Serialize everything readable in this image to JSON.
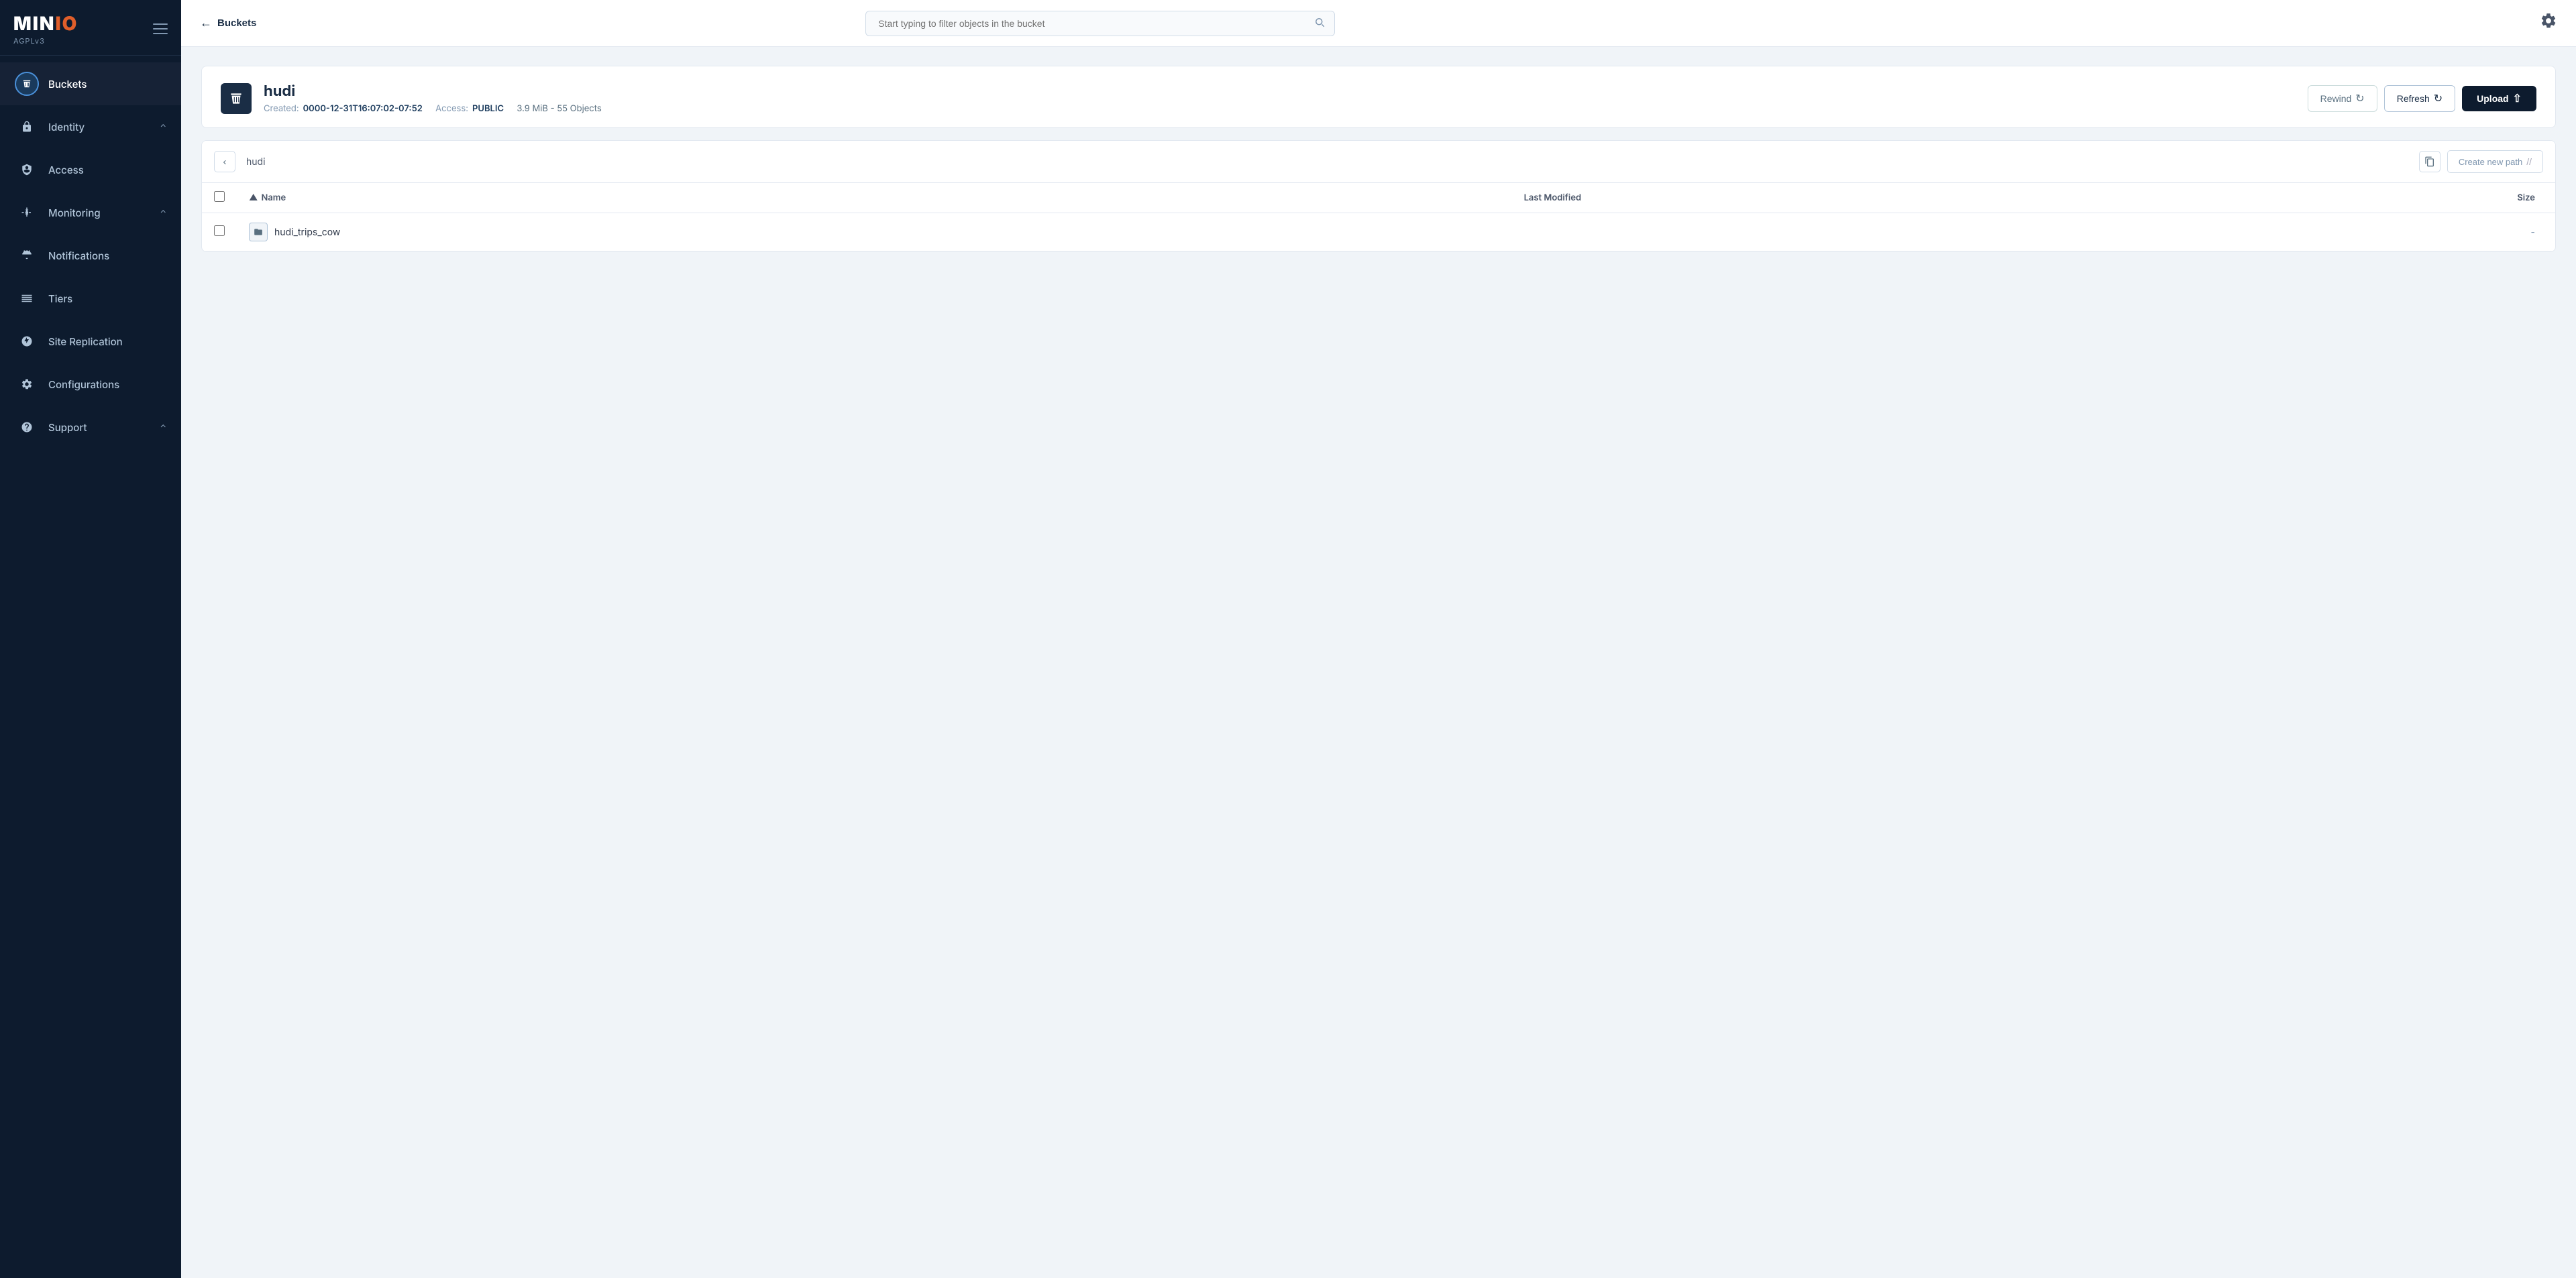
{
  "app": {
    "name": "MinIO",
    "version": "AGPLv3"
  },
  "sidebar": {
    "items": [
      {
        "id": "buckets",
        "label": "Buckets",
        "icon": "bucket",
        "active": true,
        "expandable": false
      },
      {
        "id": "identity",
        "label": "Identity",
        "icon": "identity",
        "active": false,
        "expandable": true
      },
      {
        "id": "access",
        "label": "Access",
        "icon": "access",
        "active": false,
        "expandable": false
      },
      {
        "id": "monitoring",
        "label": "Monitoring",
        "icon": "monitoring",
        "active": false,
        "expandable": true
      },
      {
        "id": "notifications",
        "label": "Notifications",
        "icon": "notifications",
        "active": false,
        "expandable": false
      },
      {
        "id": "tiers",
        "label": "Tiers",
        "icon": "tiers",
        "active": false,
        "expandable": false
      },
      {
        "id": "site-replication",
        "label": "Site Replication",
        "icon": "site-replication",
        "active": false,
        "expandable": false
      },
      {
        "id": "configurations",
        "label": "Configurations",
        "icon": "configurations",
        "active": false,
        "expandable": false
      },
      {
        "id": "support",
        "label": "Support",
        "icon": "support",
        "active": false,
        "expandable": true
      }
    ]
  },
  "topbar": {
    "back_label": "Buckets",
    "search_placeholder": "Start typing to filter objects in the bucket"
  },
  "bucket": {
    "name": "hudi",
    "created_label": "Created:",
    "created_value": "0000-12-31T16:07:02-07:52",
    "access_label": "Access:",
    "access_value": "PUBLIC",
    "stats": "3.9 MiB - 55 Objects",
    "rewind_label": "Rewind",
    "refresh_label": "Refresh",
    "upload_label": "Upload"
  },
  "file_browser": {
    "path": "hudi",
    "create_path_label": "Create new path",
    "columns": {
      "name": "Name",
      "last_modified": "Last Modified",
      "size": "Size"
    },
    "items": [
      {
        "name": "hudi_trips_cow",
        "type": "folder",
        "last_modified": "",
        "size": "-"
      }
    ]
  }
}
